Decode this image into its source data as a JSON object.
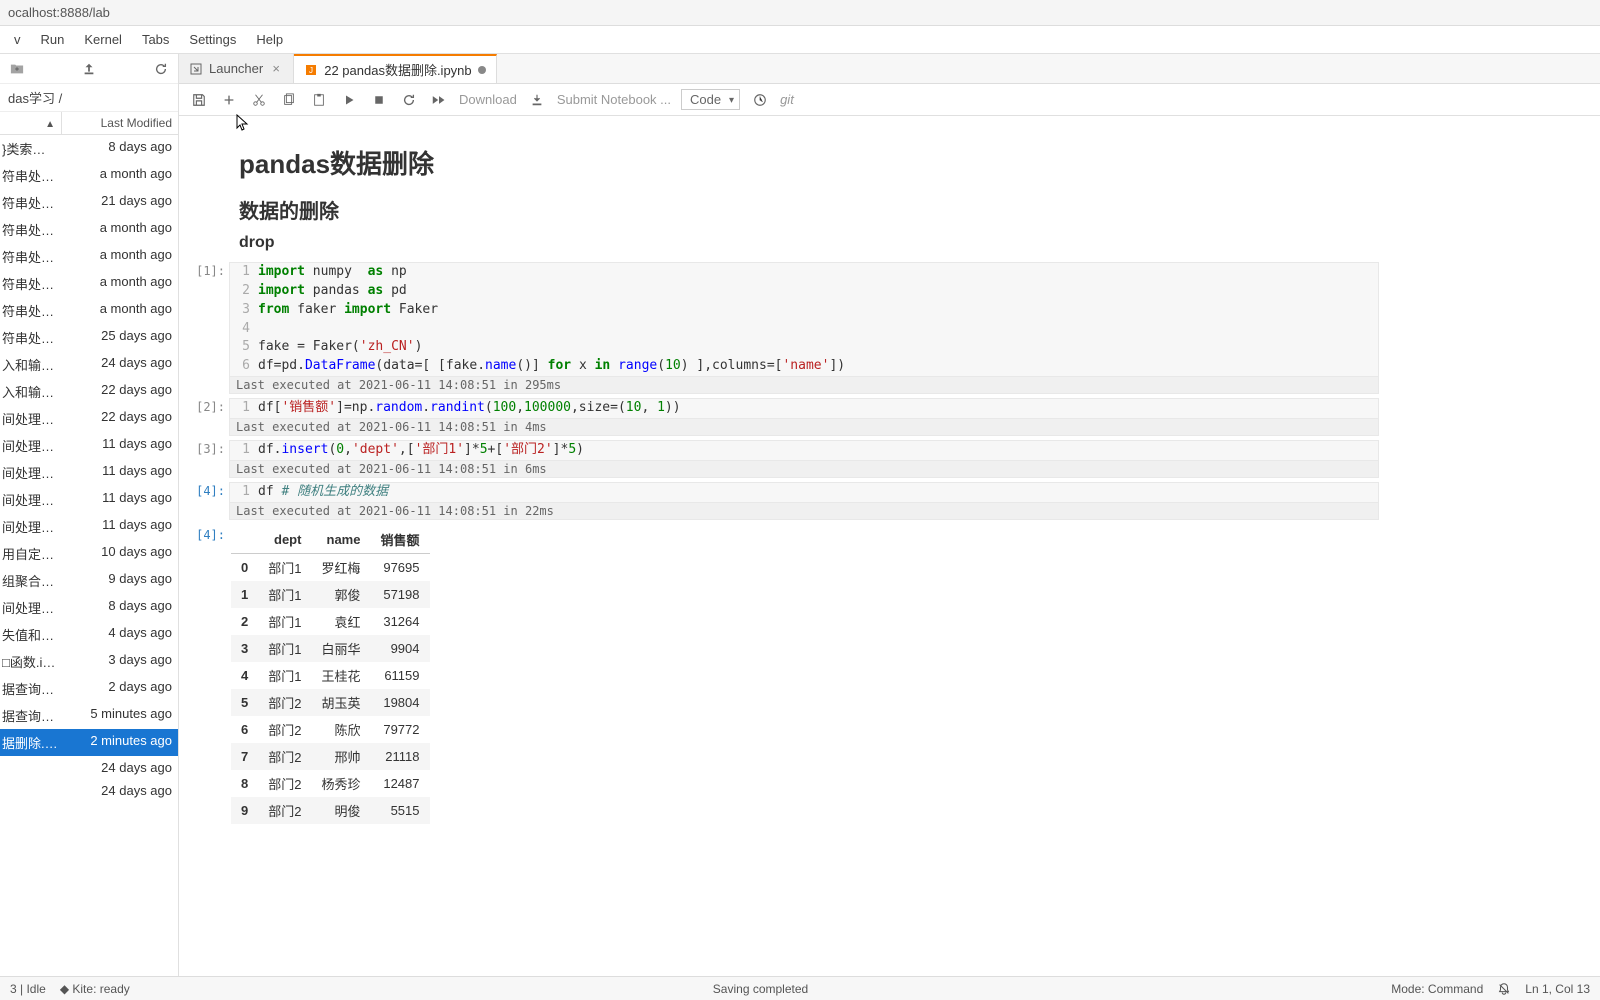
{
  "url": "ocalhost:8888/lab",
  "menus": [
    "v",
    "Run",
    "Kernel",
    "Tabs",
    "Settings",
    "Help"
  ],
  "sidebar": {
    "breadcrumb": "das学习 /",
    "cols": {
      "name": "",
      "modified": "Last Modified"
    },
    "files": [
      {
        "name": "}类索引.i...",
        "modified": "8 days ago"
      },
      {
        "name": "符串处理...",
        "modified": "a month ago"
      },
      {
        "name": "符串处理...",
        "modified": "21 days ago"
      },
      {
        "name": "符串处理...",
        "modified": "a month ago"
      },
      {
        "name": "符串处理...",
        "modified": "a month ago"
      },
      {
        "name": "符串处理...",
        "modified": "a month ago"
      },
      {
        "name": "符串处理...",
        "modified": "a month ago"
      },
      {
        "name": "符串处理...",
        "modified": "25 days ago"
      },
      {
        "name": "入和输出...",
        "modified": "24 days ago"
      },
      {
        "name": "入和输出...",
        "modified": "22 days ago"
      },
      {
        "name": "间处理（...",
        "modified": "22 days ago"
      },
      {
        "name": "间处理（...",
        "modified": "11 days ago"
      },
      {
        "name": "间处理（...",
        "modified": "11 days ago"
      },
      {
        "name": "间处理（...",
        "modified": "11 days ago"
      },
      {
        "name": "间处理（...",
        "modified": "11 days ago"
      },
      {
        "name": "用自定义...",
        "modified": "10 days ago"
      },
      {
        "name": "组聚合统...",
        "modified": "9 days ago"
      },
      {
        "name": "间处理（...",
        "modified": "8 days ago"
      },
      {
        "name": "失值和空...",
        "modified": "4 days ago"
      },
      {
        "name": "□函数.ip...",
        "modified": "3 days ago"
      },
      {
        "name": "据查询选...",
        "modified": "2 days ago"
      },
      {
        "name": "据查询选...",
        "modified": "5 minutes ago"
      },
      {
        "name": "据删除.ip...",
        "modified": "2 minutes ago",
        "selected": true
      },
      {
        "name": "",
        "modified": "24 days ago"
      },
      {
        "name": "",
        "modified": "24 days ago"
      }
    ]
  },
  "tabs": [
    {
      "label": "Launcher",
      "icon": "launcher",
      "active": false,
      "closable": true
    },
    {
      "label": "22 pandas数据删除.ipynb",
      "icon": "notebook",
      "active": true,
      "dirty": true
    }
  ],
  "toolbar": {
    "download": "Download",
    "submit": "Submit Notebook ...",
    "celltype": "Code",
    "git": "git"
  },
  "notebook": {
    "h1": "pandas数据删除",
    "h2": "数据的删除",
    "h3": "drop",
    "cells": [
      {
        "prompt": "[1]:",
        "lines": [
          [
            {
              "t": "import",
              "c": "k-keyword"
            },
            {
              "t": " numpy  "
            },
            {
              "t": "as",
              "c": "k-keyword"
            },
            {
              "t": " np"
            }
          ],
          [
            {
              "t": "import",
              "c": "k-keyword"
            },
            {
              "t": " pandas "
            },
            {
              "t": "as",
              "c": "k-keyword"
            },
            {
              "t": " pd"
            }
          ],
          [
            {
              "t": "from",
              "c": "k-keyword"
            },
            {
              "t": " faker "
            },
            {
              "t": "import",
              "c": "k-keyword"
            },
            {
              "t": " Faker"
            }
          ],
          [
            {
              "t": ""
            }
          ],
          [
            {
              "t": "fake "
            },
            {
              "t": "=",
              "c": ""
            },
            {
              "t": " Faker("
            },
            {
              "t": "'zh_CN'",
              "c": "k-string"
            },
            {
              "t": ")"
            }
          ],
          [
            {
              "t": "df"
            },
            {
              "t": "="
            },
            {
              "t": "pd"
            },
            {
              "t": "."
            },
            {
              "t": "DataFrame",
              "c": "k-name"
            },
            {
              "t": "(data"
            },
            {
              "t": "="
            },
            {
              "t": "[ [fake"
            },
            {
              "t": "."
            },
            {
              "t": "name",
              "c": "k-name"
            },
            {
              "t": "()] "
            },
            {
              "t": "for",
              "c": "k-keyword"
            },
            {
              "t": " x "
            },
            {
              "t": "in",
              "c": "k-keyword"
            },
            {
              "t": " "
            },
            {
              "t": "range",
              "c": "k-builtin"
            },
            {
              "t": "("
            },
            {
              "t": "10",
              "c": "k-number"
            },
            {
              "t": ") ],columns"
            },
            {
              "t": "="
            },
            {
              "t": "["
            },
            {
              "t": "'name'",
              "c": "k-string"
            },
            {
              "t": "])"
            }
          ]
        ],
        "exec": "Last executed at 2021-06-11 14:08:51 in 295ms"
      },
      {
        "prompt": "[2]:",
        "lines": [
          [
            {
              "t": "df["
            },
            {
              "t": "'销售额'",
              "c": "k-string"
            },
            {
              "t": "]"
            },
            {
              "t": "="
            },
            {
              "t": "np"
            },
            {
              "t": "."
            },
            {
              "t": "random",
              "c": "k-name"
            },
            {
              "t": "."
            },
            {
              "t": "randint",
              "c": "k-name"
            },
            {
              "t": "("
            },
            {
              "t": "100",
              "c": "k-number"
            },
            {
              "t": ","
            },
            {
              "t": "100000",
              "c": "k-number"
            },
            {
              "t": ",size"
            },
            {
              "t": "="
            },
            {
              "t": "("
            },
            {
              "t": "10",
              "c": "k-number"
            },
            {
              "t": ", "
            },
            {
              "t": "1",
              "c": "k-number"
            },
            {
              "t": "))"
            }
          ]
        ],
        "exec": "Last executed at 2021-06-11 14:08:51 in 4ms"
      },
      {
        "prompt": "[3]:",
        "lines": [
          [
            {
              "t": "df"
            },
            {
              "t": "."
            },
            {
              "t": "insert",
              "c": "k-name"
            },
            {
              "t": "("
            },
            {
              "t": "0",
              "c": "k-number"
            },
            {
              "t": ","
            },
            {
              "t": "'dept'",
              "c": "k-string"
            },
            {
              "t": ",["
            },
            {
              "t": "'部门1'",
              "c": "k-string"
            },
            {
              "t": "]"
            },
            {
              "t": "*"
            },
            {
              "t": "5",
              "c": "k-number"
            },
            {
              "t": "+"
            },
            {
              "t": "["
            },
            {
              "t": "'部门2'",
              "c": "k-string"
            },
            {
              "t": "]"
            },
            {
              "t": "*"
            },
            {
              "t": "5",
              "c": "k-number"
            },
            {
              "t": ")"
            }
          ]
        ],
        "exec": "Last executed at 2021-06-11 14:08:51 in 6ms"
      },
      {
        "prompt": "[4]:",
        "active": true,
        "lines": [
          [
            {
              "t": "df "
            },
            {
              "t": "# 随机生成的数据",
              "c": "k-comment"
            }
          ]
        ],
        "exec": "Last executed at 2021-06-11 14:08:51 in 22ms"
      }
    ],
    "output": {
      "prompt": "[4]:",
      "active": true,
      "headers": [
        "",
        "dept",
        "name",
        "销售额"
      ],
      "rows": [
        [
          "0",
          "部门1",
          "罗红梅",
          "97695"
        ],
        [
          "1",
          "部门1",
          "郭俊",
          "57198"
        ],
        [
          "2",
          "部门1",
          "袁红",
          "31264"
        ],
        [
          "3",
          "部门1",
          "白丽华",
          "9904"
        ],
        [
          "4",
          "部门1",
          "王桂花",
          "61159"
        ],
        [
          "5",
          "部门2",
          "胡玉英",
          "19804"
        ],
        [
          "6",
          "部门2",
          "陈欣",
          "79772"
        ],
        [
          "7",
          "部门2",
          "邢帅",
          "21118"
        ],
        [
          "8",
          "部门2",
          "杨秀珍",
          "12487"
        ],
        [
          "9",
          "部门2",
          "明俊",
          "5515"
        ]
      ]
    }
  },
  "status": {
    "kernel": "3 | Idle",
    "kite": "Kite: ready",
    "center": "Saving completed",
    "mode": "Mode: Command",
    "pos": "Ln 1, Col 13"
  }
}
